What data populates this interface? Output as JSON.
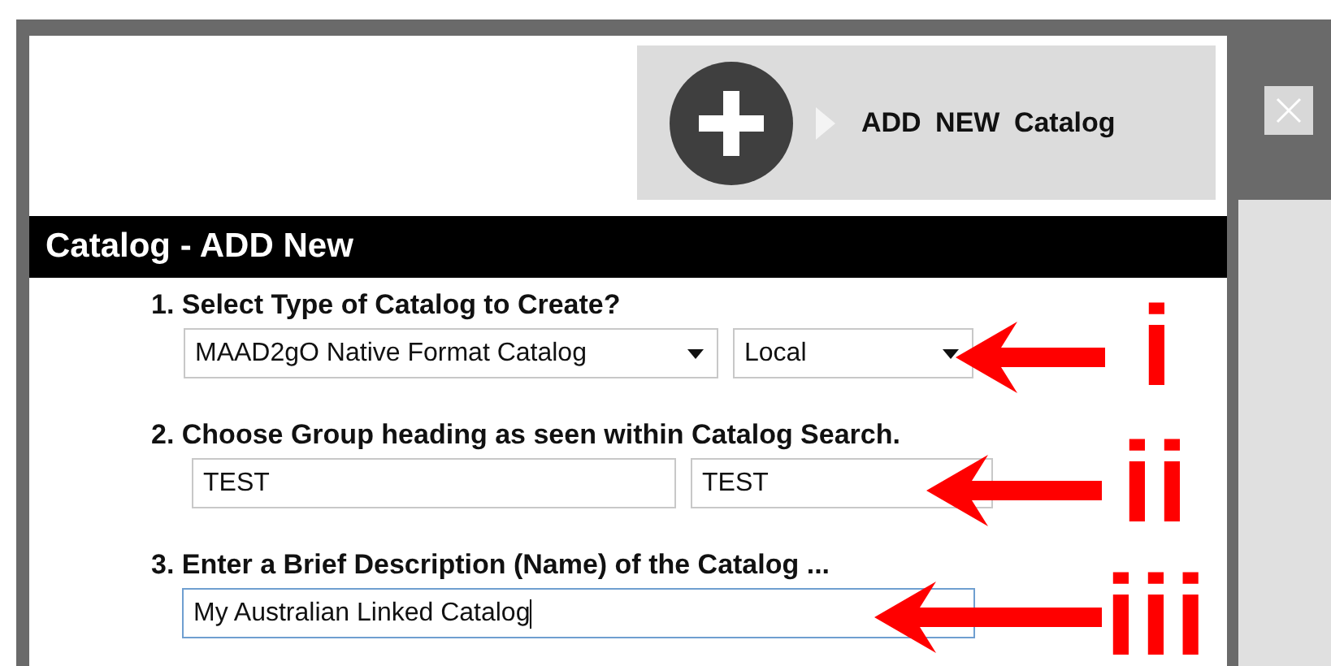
{
  "header": {
    "add_button": {
      "label": "ADD NEW Catalog"
    }
  },
  "section_title": "Catalog - ADD New",
  "steps": [
    {
      "label": "1. Select Type of Catalog to Create?",
      "fields": [
        {
          "kind": "dropdown",
          "value": "MAAD2gO Native Format Catalog",
          "focused": false
        },
        {
          "kind": "dropdown",
          "value": "Local",
          "focused": false
        }
      ]
    },
    {
      "label": "2. Choose Group heading as seen within Catalog Search.",
      "fields": [
        {
          "kind": "text",
          "value": "TEST",
          "focused": false
        },
        {
          "kind": "text",
          "value": "TEST",
          "focused": false
        }
      ]
    },
    {
      "label": "3. Enter a Brief Description (Name) of the Catalog ...",
      "fields": [
        {
          "kind": "text",
          "value": "My Australian Linked Catalog",
          "focused": true
        }
      ]
    }
  ],
  "annotations": [
    {
      "label": "i"
    },
    {
      "label": "ii"
    },
    {
      "label": "iii"
    }
  ]
}
